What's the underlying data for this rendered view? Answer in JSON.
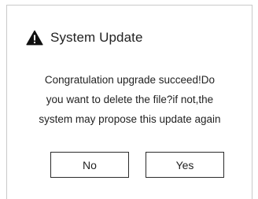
{
  "dialog": {
    "title": "System Update",
    "title_icon": "warning-icon",
    "message_lines": [
      "Congratulation upgrade succeed!Do",
      "you want to delete the file?if not,the",
      "system may propose this update again"
    ],
    "buttons": {
      "no_label": "No",
      "yes_label": "Yes"
    }
  },
  "colors": {
    "background": "#ffffff",
    "border": "#c9c9c9",
    "text": "#222222",
    "button_border": "#2b2b2b",
    "icon": "#111111"
  }
}
